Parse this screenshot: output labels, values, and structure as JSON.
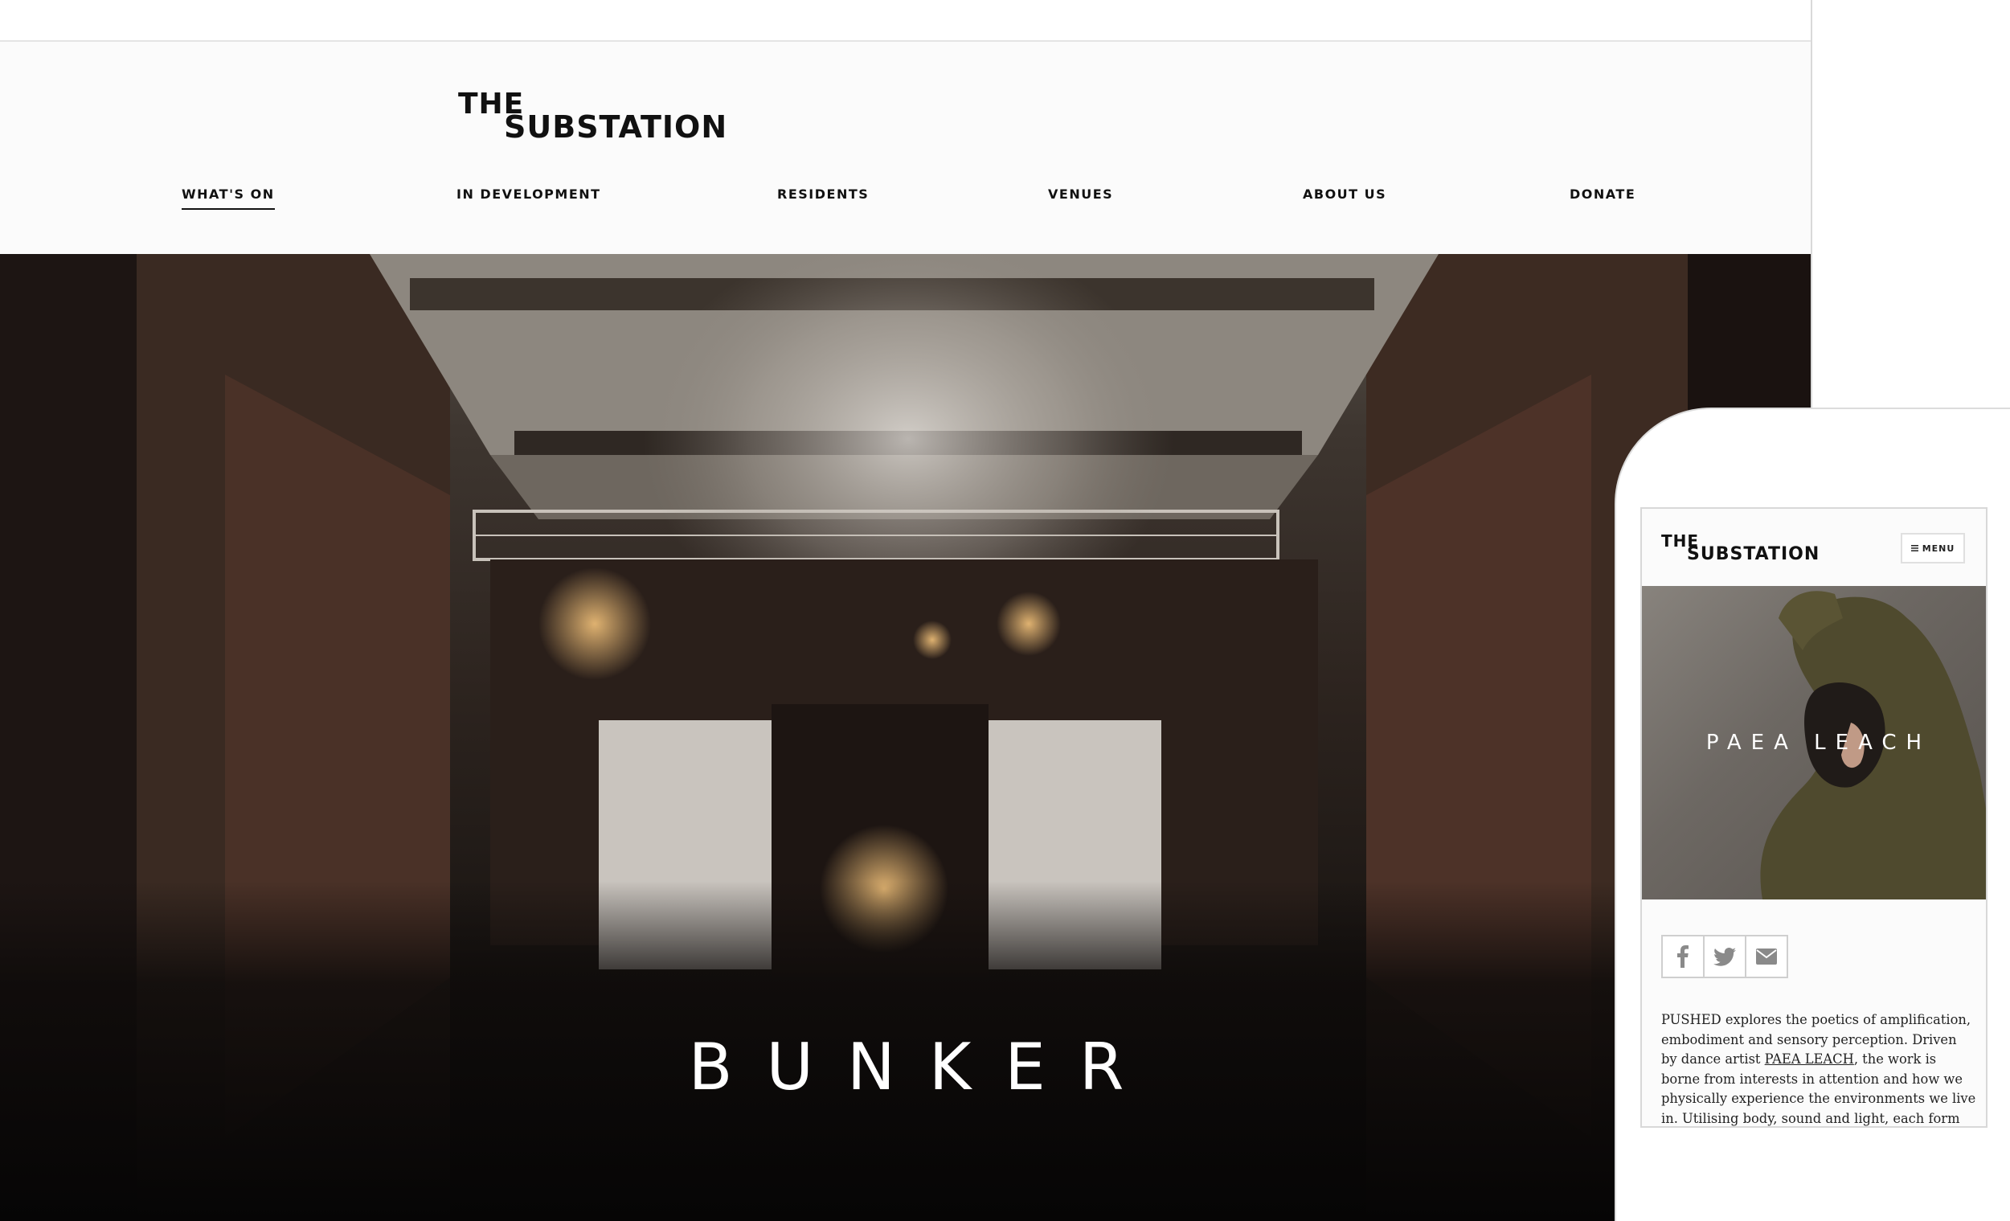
{
  "brand": {
    "line1": "THE",
    "line2": "SUBSTATION"
  },
  "nav": [
    {
      "label": "WHAT'S ON",
      "active": true
    },
    {
      "label": "IN DEVELOPMENT"
    },
    {
      "label": "RESIDENTS"
    },
    {
      "label": "VENUES"
    },
    {
      "label": "ABOUT US"
    },
    {
      "label": "DONATE"
    }
  ],
  "hero": {
    "title": "BUNKER"
  },
  "mobile": {
    "menu_label": "MENU",
    "feature_title": "PAEA LEACH",
    "share": [
      {
        "icon": "facebook-icon"
      },
      {
        "icon": "twitter-icon"
      },
      {
        "icon": "email-icon"
      }
    ],
    "body": {
      "before_link": "PUSHED explores the poetics of amplification, embodiment and sensory perception. Driven by dance artist ",
      "link": "PAEA LEACH",
      "after_link": ", the work is borne from interests in attention and how we physically experience the environments we live in. Utilising body, sound and light, each form pushes towards"
    }
  },
  "colors": {
    "text": "#111111",
    "background": "#fbfbfb",
    "border": "#d9d9d9"
  }
}
